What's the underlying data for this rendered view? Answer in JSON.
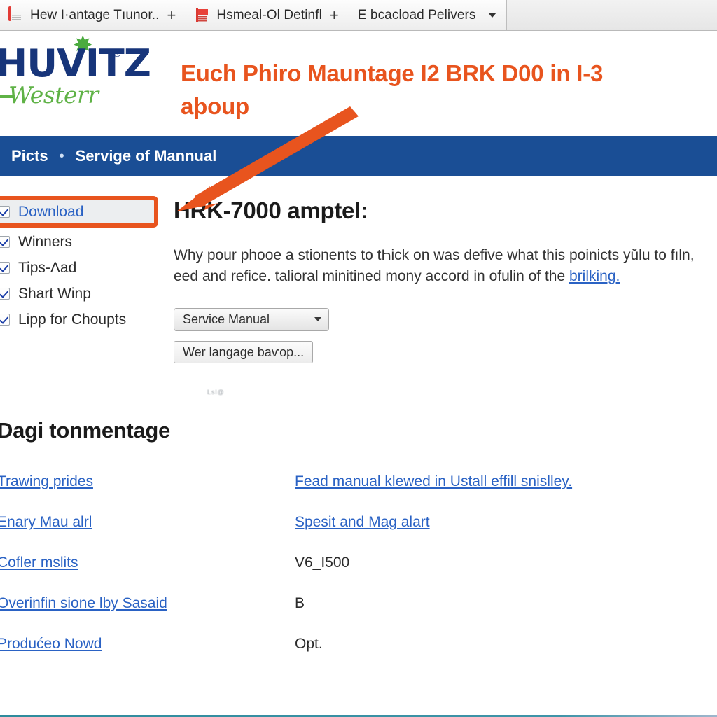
{
  "browser": {
    "tabs": [
      {
        "icon": "document-favicon",
        "label": "Hew Ӏ·antage Tıunor..",
        "affordance": "+"
      },
      {
        "icon": "flag-favicon",
        "label": "Hsmeal-Ol Detinfl",
        "affordance": "+"
      },
      {
        "icon": "none",
        "label": "E bcacload Pelivers",
        "affordance": "caret"
      }
    ]
  },
  "site": {
    "logo": {
      "wordmark": "HUVITZ",
      "registered": "®",
      "star": "✸",
      "tagline": "Westerr"
    },
    "headline": "Euch Phiro Mauntage I2 BRK D00 in Ӏ-3 aþoup",
    "nav": [
      {
        "label": "Picts"
      },
      {
        "label": "Servige of Mannual"
      }
    ],
    "nav_separator": "•"
  },
  "sidebar": {
    "items": [
      {
        "label": "Download",
        "checked": true,
        "is_link": true,
        "highlighted": true
      },
      {
        "label": "Winners",
        "checked": true,
        "is_link": false,
        "highlighted": false
      },
      {
        "label": "Tips-Ʌad",
        "checked": true,
        "is_link": false,
        "highlighted": false
      },
      {
        "label": "Shart Winp",
        "checked": true,
        "is_link": false,
        "highlighted": false
      },
      {
        "label": "Lipp for Choupts",
        "checked": true,
        "is_link": false,
        "highlighted": false
      }
    ]
  },
  "content": {
    "heading": "HRK-7000 amptel:",
    "paragraph_part1": "Why pour phooe a stionents to tҺick on was defive what this poinicts yŭlu to fıln, eed and refice. talioral minitined mony accord in ofulin of the ",
    "paragraph_link": "brilking.",
    "select": {
      "value": "Service Manual",
      "caret": "▾"
    },
    "button_label": "Wer langage baѵop...",
    "smudge": "Lsl@"
  },
  "lower": {
    "heading": "Dagi tonmentage",
    "rows": [
      {
        "left": "Trawing prides",
        "left_is_link": true,
        "right": "Fead manual klewed in Ustall effill snislley.",
        "right_is_link": true
      },
      {
        "left": "Enary Mau alrl",
        "left_is_link": true,
        "right": "Spesit and Mag alart",
        "right_is_link": true
      },
      {
        "left": "Cofler mslits",
        "left_is_link": true,
        "right": "V6_I500",
        "right_is_link": false
      },
      {
        "left": "Overinfin sione lby Sasaid",
        "left_is_link": true,
        "right": "B",
        "right_is_link": false
      },
      {
        "left": "Produćeo Nowd",
        "left_is_link": true,
        "right": "Opt.",
        "right_is_link": false
      }
    ]
  },
  "annotation": {
    "arrow_color": "#e8541e",
    "highlight_color": "#e8541e"
  },
  "colors": {
    "nav_blue": "#1a4e95",
    "brand_navy": "#17357a",
    "brand_green": "#5fb246",
    "accent_orange": "#e8541e",
    "link_blue": "#2a62c4"
  }
}
